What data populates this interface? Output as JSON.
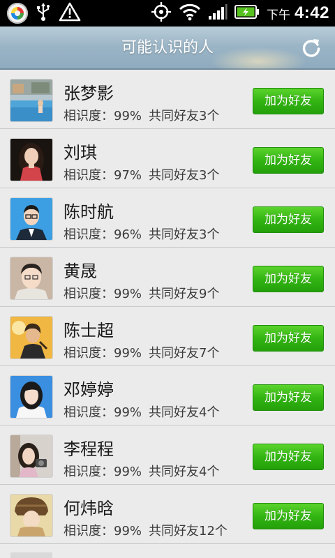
{
  "status_bar": {
    "ampm": "下午",
    "time": "4:42",
    "icons": [
      "app-icon",
      "usb-icon",
      "warning-icon",
      "gps-icon",
      "wifi-icon",
      "signal-icon",
      "battery-icon"
    ]
  },
  "header": {
    "title": "可能认识的人",
    "refresh_icon": "refresh-icon"
  },
  "friends": [
    {
      "name": "张梦影",
      "familiarity_label": "相识度：",
      "familiarity": "99%",
      "common_label": "共同好友",
      "common_count": "3",
      "common_suffix": "个",
      "button": "加为好友"
    },
    {
      "name": "刘琪",
      "familiarity_label": "相识度：",
      "familiarity": "97%",
      "common_label": "共同好友",
      "common_count": "3",
      "common_suffix": "个",
      "button": "加为好友"
    },
    {
      "name": "陈时航",
      "familiarity_label": "相识度：",
      "familiarity": "96%",
      "common_label": "共同好友",
      "common_count": "3",
      "common_suffix": "个",
      "button": "加为好友"
    },
    {
      "name": "黄晟",
      "familiarity_label": "相识度：",
      "familiarity": "99%",
      "common_label": "共同好友",
      "common_count": "9",
      "common_suffix": "个",
      "button": "加为好友"
    },
    {
      "name": "陈士超",
      "familiarity_label": "相识度：",
      "familiarity": "99%",
      "common_label": "共同好友",
      "common_count": "7",
      "common_suffix": "个",
      "button": "加为好友"
    },
    {
      "name": "邓婷婷",
      "familiarity_label": "相识度：",
      "familiarity": "99%",
      "common_label": "共同好友",
      "common_count": "4",
      "common_suffix": "个",
      "button": "加为好友"
    },
    {
      "name": "李程程",
      "familiarity_label": "相识度：",
      "familiarity": "99%",
      "common_label": "共同好友",
      "common_count": "4",
      "common_suffix": "个",
      "button": "加为好友"
    },
    {
      "name": "何炜晗",
      "familiarity_label": "相识度：",
      "familiarity": "99%",
      "common_label": "共同好友",
      "common_count": "12",
      "common_suffix": "个",
      "button": "加为好友"
    }
  ],
  "colors": {
    "accent_green": "#33b513",
    "header_blue": "#9bb5c6",
    "list_background": "#ebebeb"
  }
}
